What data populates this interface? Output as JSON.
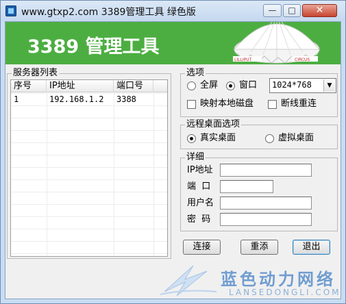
{
  "window": {
    "title": "www.gtxp2.com 3389管理工具 绿色版",
    "minimize_glyph": "—",
    "maximize_glyph": "□",
    "close_glyph": "✕"
  },
  "banner": {
    "title": "3389 管理工具",
    "tent_flag_left": "LILLIPUT",
    "tent_flag_right": "CIRCUS",
    "background_color": "#4cae41"
  },
  "servers": {
    "legend": "服务器列表",
    "columns": [
      "序号",
      "IP地址",
      "端口号"
    ],
    "rows": [
      {
        "index": "1",
        "ip": "192.168.1.2",
        "port": "3388"
      }
    ]
  },
  "options": {
    "legend": "选项",
    "fullscreen_label": "全屏",
    "window_label": "窗口",
    "display_mode": "window",
    "resolution": "1024*768",
    "map_disk_label": "映射本地磁盘",
    "map_disk_checked": false,
    "reconnect_label": "断线重连",
    "reconnect_checked": false
  },
  "remote_desktop": {
    "legend": "远程桌面选项",
    "real_label": "真实桌面",
    "virtual_label": "虚拟桌面",
    "selected": "real"
  },
  "detail": {
    "legend": "详细",
    "ip_label": "IP地址",
    "port_label": "端  口",
    "user_label": "用户名",
    "password_label": "密  码",
    "ip_value": "",
    "port_value": "",
    "user_value": "",
    "password_value": ""
  },
  "buttons": {
    "connect": "连接",
    "reset": "重添",
    "exit": "退出"
  },
  "watermark": {
    "text": "蓝色动力网络",
    "sub": "LANSEDONGLI.COM"
  }
}
